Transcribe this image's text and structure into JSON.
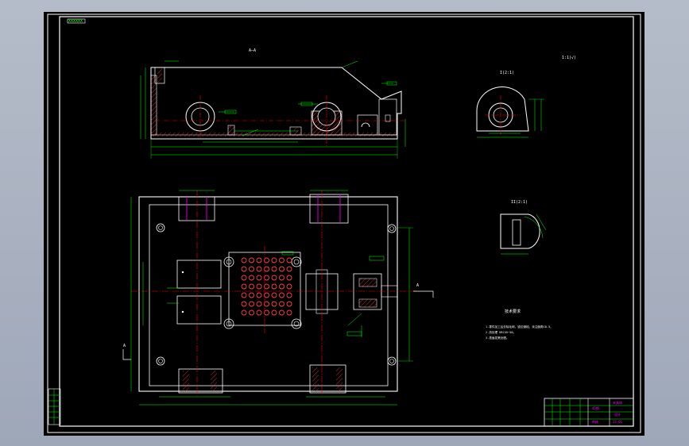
{
  "drawing": {
    "corner_stamp": "XXXXXX",
    "section_label": "A—A",
    "scale_note": "1:1(√)",
    "detail_label_1": "I(2:1)",
    "detail_label_2": "II(2:1)",
    "view_arrow_label": "A",
    "tech_req_title": "技术要求",
    "tech_req_lines": [
      "1.零件加工后去除毛刺，锐边倒钝，未注倒角C0.5。",
      "2.热处理 HRC45~50。",
      "3.表面发黑处理。"
    ]
  },
  "title_block": {
    "part_name": "夹具体",
    "material": "45钢",
    "drawing_no": "JJ-01",
    "designer": "设计",
    "checker": "审核"
  },
  "colors": {
    "background": "#000000",
    "outline": "#ffffff",
    "dimension": "#00ff00",
    "centerline": "#ff0000",
    "hatch": "#ff3030",
    "highlight": "#ff00ff",
    "hole": "#ff4040",
    "title_text": "#ff00ff"
  }
}
